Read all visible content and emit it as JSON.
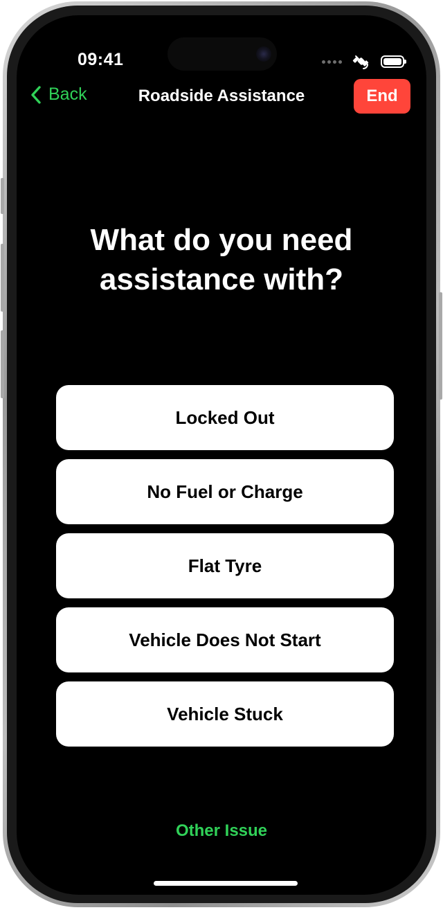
{
  "status_bar": {
    "time": "09:41",
    "icons": [
      "cellular-dots-icon",
      "satellite-icon",
      "battery-icon"
    ]
  },
  "nav": {
    "back_label": "Back",
    "back_icon": "chevron-left-icon",
    "title": "Roadside Assistance",
    "end_label": "End"
  },
  "main": {
    "question": "What do you need assistance with?",
    "options": [
      {
        "label": "Locked Out"
      },
      {
        "label": "No Fuel or Charge"
      },
      {
        "label": "Flat Tyre"
      },
      {
        "label": "Vehicle Does Not Start"
      },
      {
        "label": "Vehicle Stuck"
      }
    ],
    "other_label": "Other Issue"
  },
  "colors": {
    "background": "#000000",
    "accent_green": "#30d158",
    "end_red": "#ff453a",
    "option_bg": "#ffffff",
    "text_primary": "#ffffff"
  }
}
